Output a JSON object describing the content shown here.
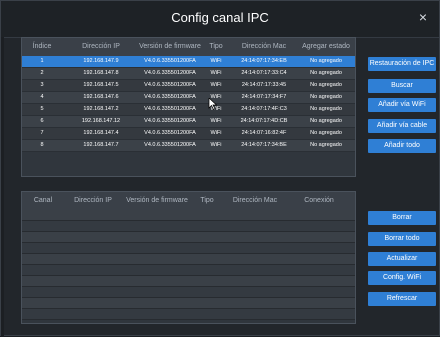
{
  "dialog": {
    "title": "Config canal IPC",
    "close_glyph": "×"
  },
  "top_table": {
    "headers": [
      "Índice",
      "Dirección IP",
      "Versión de firmware",
      "Tipo",
      "Dirección Mac",
      "Agregar estado"
    ],
    "rows": [
      {
        "index": "1",
        "ip": "192.168.147.9",
        "firmware": "V4.0.6.335501200FA",
        "type": "WiFi",
        "mac": "24:14:07:17:34:EB",
        "status": "No agregado"
      },
      {
        "index": "2",
        "ip": "192.168.147.8",
        "firmware": "V4.0.6.335501200FA",
        "type": "WiFi",
        "mac": "24:14:07:17:33:C4",
        "status": "No agregado"
      },
      {
        "index": "3",
        "ip": "192.168.147.5",
        "firmware": "V4.0.6.335501200FA",
        "type": "WiFi",
        "mac": "24:14:07:17:33:45",
        "status": "No agregado"
      },
      {
        "index": "4",
        "ip": "192.168.147.6",
        "firmware": "V4.0.6.335501200FA",
        "type": "WiFi",
        "mac": "24:14:07:17:34:F7",
        "status": "No agregado"
      },
      {
        "index": "5",
        "ip": "192.168.147.2",
        "firmware": "V4.0.6.335501200FA",
        "type": "WiFi",
        "mac": "24:14:07:17:4F:C3",
        "status": "No agregado"
      },
      {
        "index": "6",
        "ip": "192.168.147.12",
        "firmware": "V4.0.6.335501200FA",
        "type": "WiFi",
        "mac": "24:14:07:17:4D:CB",
        "status": "No agregado"
      },
      {
        "index": "7",
        "ip": "192.168.147.4",
        "firmware": "V4.0.6.335501200FA",
        "type": "WiFi",
        "mac": "24:14:07:16:82:4F",
        "status": "No agregado"
      },
      {
        "index": "8",
        "ip": "192.168.147.7",
        "firmware": "V4.0.6.335501200FA",
        "type": "WiFi",
        "mac": "24:14:07:17:34:BE",
        "status": "No agregado"
      }
    ],
    "selected_row": 0
  },
  "bottom_table": {
    "headers": [
      "Canal",
      "Dirección IP",
      "Versión de firmware",
      "Tipo",
      "Dirección Mac",
      "Conexión"
    ]
  },
  "top_buttons": [
    "Restauración de IPC",
    "Buscar",
    "Añadir vía WiFi",
    "Añadir vía cable",
    "Añadir todo"
  ],
  "bottom_buttons": [
    "Borrar",
    "Borrar todo",
    "Actualizar",
    "Config. WiFi",
    "Refrescar"
  ],
  "colors": {
    "accent": "#2f7fd5",
    "background": "#22262b",
    "table": "#30363d"
  }
}
